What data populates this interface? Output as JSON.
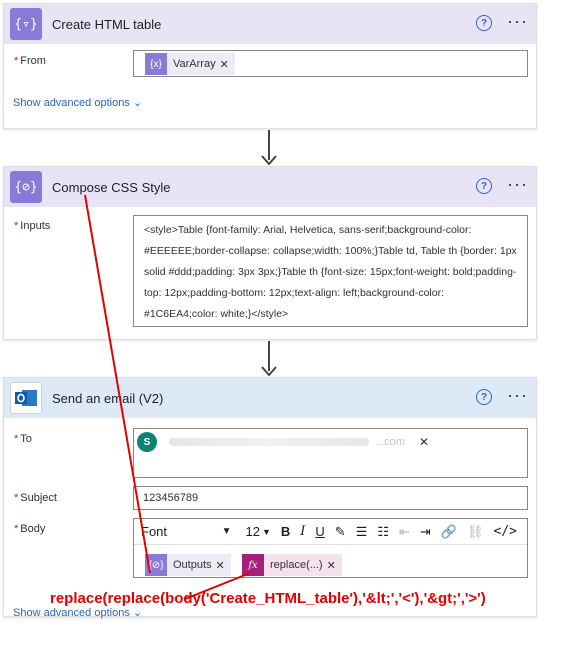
{
  "cards": {
    "create_html": {
      "title": "Create HTML table",
      "from_label": "From",
      "from_token": "VarArray",
      "advanced": "Show advanced options"
    },
    "compose": {
      "title": "Compose CSS Style",
      "inputs_label": "Inputs",
      "inputs_value": "<style>Table {font-family: Arial, Helvetica, sans-serif;background-color: #EEEEEE;border-collapse: collapse;width: 100%;}Table td, Table th {border: 1px solid #ddd;padding: 3px 3px;}Table th {font-size: 15px;font-weight: bold;padding-top: 12px;padding-bottom: 12px;text-align: left;background-color: #1C6EA4;color: white;}</style>"
    },
    "email": {
      "title": "Send an email (V2)",
      "to_label": "To",
      "to_avatar": "S",
      "to_suffix": "...com",
      "subject_label": "Subject",
      "subject_value": "123456789",
      "body_label": "Body",
      "font_name": "Font",
      "font_size": "12",
      "outputs_token": "Outputs",
      "replace_token": "replace(...)",
      "advanced": "Show advanced options"
    }
  },
  "annotation": "replace(replace(body('Create_HTML_table'),'&lt;','<'),'&gt;','>')",
  "icons": {
    "help": "help-icon",
    "more": "more-icon",
    "variable": "variable-icon",
    "outlook": "outlook-icon",
    "expression": "fx-icon"
  },
  "colors": {
    "variable_header": "#e8e4f5",
    "email_header": "#dde9f6",
    "variable_icon": "#8a7ad8",
    "expression_icon": "#a4207b",
    "annotation": "#e30000",
    "link": "#2b65c2"
  }
}
